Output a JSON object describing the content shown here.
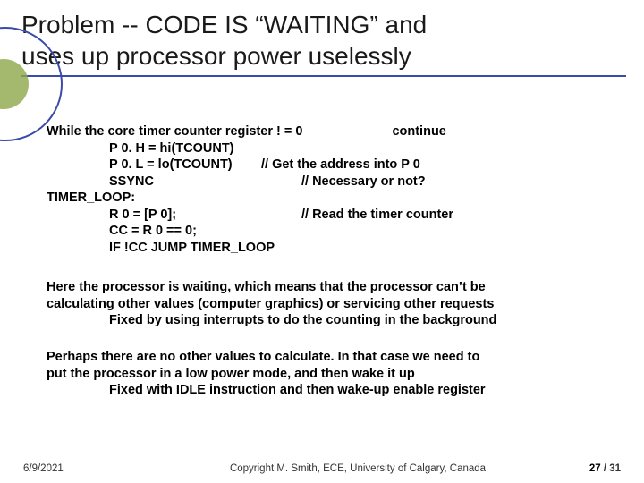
{
  "title": {
    "line1": "Problem --  CODE IS “WAITING” and",
    "line2": "uses up processor power uselessly"
  },
  "code": {
    "l1a": "While the core timer counter register ! = 0",
    "l1b": "continue",
    "l2": "P 0. H = hi(TCOUNT)",
    "l3a": "P 0. L = lo(TCOUNT)",
    "l3b": "// Get the address into P 0",
    "l4a": "SSYNC",
    "l4b": "// Necessary or not?",
    "l5": "TIMER_LOOP:",
    "l6a": "R 0 = [P 0];",
    "l6b": "// Read the timer counter",
    "l7": "CC = R 0 == 0;",
    "l8": "IF !CC JUMP TIMER_LOOP"
  },
  "para1": {
    "t1": "Here the processor is waiting, which means that the processor can’t be",
    "t2": "calculating other values (computer graphics) or servicing other requests",
    "t3": "Fixed by using interrupts to do the counting in the background"
  },
  "para2": {
    "t1": "Perhaps there are no other values to calculate. In that case we need to",
    "t2": "put the processor in a low power mode, and then wake it up",
    "t3": "Fixed with IDLE instruction and then wake-up enable register"
  },
  "footer": {
    "date": "6/9/2021",
    "copyright": "Copyright M. Smith, ECE, University of Calgary, Canada",
    "page_current": "27",
    "page_sep": " / ",
    "page_total": "31"
  }
}
